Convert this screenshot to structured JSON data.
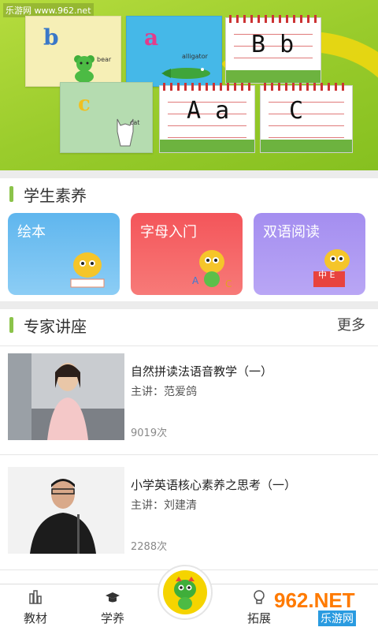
{
  "watermark": "乐游网 www.962.net",
  "banner": {
    "cards": [
      {
        "letter": "b",
        "word": "bear"
      },
      {
        "letter": "a",
        "word": "alligator"
      },
      {
        "letter": "c",
        "word": "cat"
      }
    ],
    "notebooks": [
      {
        "text": "B b"
      },
      {
        "text": "A a"
      },
      {
        "text": "C"
      }
    ]
  },
  "student": {
    "title": "学生素养",
    "tiles": [
      {
        "label": "绘本",
        "color": "#5fb6ee"
      },
      {
        "label": "字母入门",
        "color": "#f4555a"
      },
      {
        "label": "双语阅读",
        "color": "#a48ef0"
      }
    ],
    "badge": "中 E"
  },
  "experts": {
    "title": "专家讲座",
    "more": "更多",
    "lectures": [
      {
        "title": "自然拼读法语音教学（一）",
        "speaker": "主讲：范爱鸽",
        "views": "9019次"
      },
      {
        "title": "小学英语核心素养之思考（一）",
        "speaker": "主讲：刘建清",
        "views": "2288次"
      }
    ]
  },
  "nav": {
    "items": [
      {
        "label": "教材"
      },
      {
        "label": "学养"
      },
      {
        "label": "拓展"
      }
    ],
    "brand_text": "962.NET",
    "brand_sub": "乐游网"
  },
  "colors": {
    "accent_green": "#8bc34a",
    "yellow": "#f5d400"
  }
}
